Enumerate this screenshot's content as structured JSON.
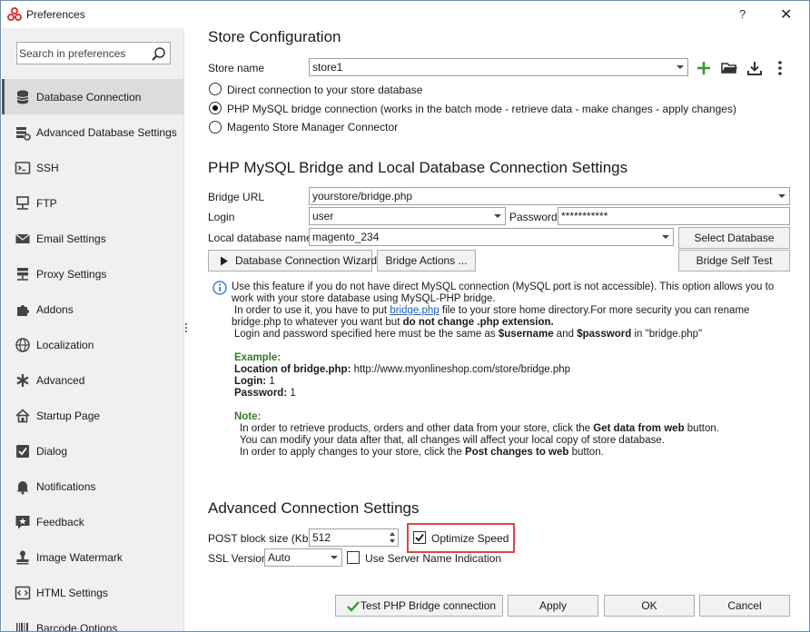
{
  "window": {
    "title": "Preferences",
    "help_glyph": "?",
    "close_glyph": "✕"
  },
  "sidebar": {
    "search_placeholder": "Search in preferences",
    "items": [
      {
        "label": "Database Connection",
        "icon": "database-icon",
        "active": true
      },
      {
        "label": "Advanced Database Settings",
        "icon": "database-settings-icon",
        "active": false
      },
      {
        "label": "SSH",
        "icon": "terminal-icon",
        "active": false
      },
      {
        "label": "FTP",
        "icon": "ftp-network-icon",
        "active": false
      },
      {
        "label": "Email Settings",
        "icon": "envelope-icon",
        "active": false
      },
      {
        "label": "Proxy Settings",
        "icon": "proxy-server-icon",
        "active": false
      },
      {
        "label": "Addons",
        "icon": "puzzle-icon",
        "active": false
      },
      {
        "label": "Localization",
        "icon": "globe-icon",
        "active": false
      },
      {
        "label": "Advanced",
        "icon": "asterisk-icon",
        "active": false
      },
      {
        "label": "Startup Page",
        "icon": "home-icon",
        "active": false
      },
      {
        "label": "Dialog",
        "icon": "checkbox-icon",
        "active": false
      },
      {
        "label": "Notifications",
        "icon": "bell-icon",
        "active": false
      },
      {
        "label": "Feedback",
        "icon": "feedback-star-icon",
        "active": false
      },
      {
        "label": "Image Watermark",
        "icon": "stamp-icon",
        "active": false
      },
      {
        "label": "HTML Settings",
        "icon": "html-code-icon",
        "active": false
      },
      {
        "label": "Barcode Options",
        "icon": "barcode-icon",
        "active": false
      }
    ]
  },
  "store_config": {
    "heading": "Store Configuration",
    "store_name_label": "Store name",
    "store_name_value": "store1",
    "radio_options": [
      {
        "label": "Direct connection to your store database",
        "checked": false
      },
      {
        "label": "PHP MySQL bridge connection (works in the batch mode - retrieve data - make changes - apply changes)",
        "checked": true
      },
      {
        "label": "Magento Store Manager Connector",
        "checked": false
      }
    ]
  },
  "bridge": {
    "heading": "PHP MySQL Bridge and Local Database Connection Settings",
    "bridge_url_label": "Bridge URL",
    "bridge_url_value": "yourstore/bridge.php",
    "login_label": "Login",
    "login_value": "user",
    "password_label": "Password",
    "password_value": "***********",
    "local_db_label": "Local database name",
    "local_db_value": "magento_234",
    "select_db_button": "Select Database",
    "wizard_button": "Database Connection Wizard",
    "bridge_actions_button": "Bridge Actions ...",
    "self_test_button": "Bridge Self Test"
  },
  "info": {
    "line1": "Use this feature if you do not have direct MySQL connection (MySQL port is not accessible). This option allows you to",
    "line2": "work with your store database using MySQL-PHP bridge.",
    "line3_pre": "In order to use it, you have to put ",
    "line3_link": "bridge.php",
    "line3_post": " file to your store home directory.For more security you can rename",
    "line4_pre": "bridge.php to whatever you want but ",
    "line4_bold": "do not change .php extension.",
    "line5_pre": "Login and password specified here must be the same as ",
    "line5_b1": "$username",
    "line5_mid": " and ",
    "line5_b2": "$password",
    "line5_post": " in \"bridge.php\"",
    "example_heading": "Example:",
    "ex_location_label": "Location of bridge.php:",
    "ex_location_value": " http://www.myonlineshop.com/store/bridge.php",
    "ex_login_label": "Login:",
    "ex_login_value": " 1",
    "ex_password_label": "Password:",
    "ex_password_value": " 1",
    "note_heading": "Note:",
    "note1_pre": "In order to retrieve products, orders and other data from your store, click the ",
    "note1_bold": "Get data from web",
    "note1_post": " button.",
    "note2": "You can modify your data after that, all changes will affect your local copy of store database.",
    "note3_pre": "In order to apply changes to your store, click the ",
    "note3_bold": "Post changes to web",
    "note3_post": " button."
  },
  "advanced": {
    "heading": "Advanced Connection Settings",
    "post_block_label": "POST block size (Kb)",
    "post_block_value": "512",
    "optimize_speed_label": "Optimize Speed",
    "optimize_speed_checked": true,
    "ssl_label": "SSL Version",
    "ssl_value": "Auto",
    "sni_label": "Use Server Name Indication",
    "sni_checked": false
  },
  "footer": {
    "test_button": "Test PHP Bridge connection",
    "apply_button": "Apply",
    "ok_button": "OK",
    "cancel_button": "Cancel"
  },
  "colors": {
    "accent_green": "#2f9e2f",
    "highlight_red": "#e0443c",
    "link_blue": "#1f5fbf",
    "note_green": "#2f7d1f"
  }
}
